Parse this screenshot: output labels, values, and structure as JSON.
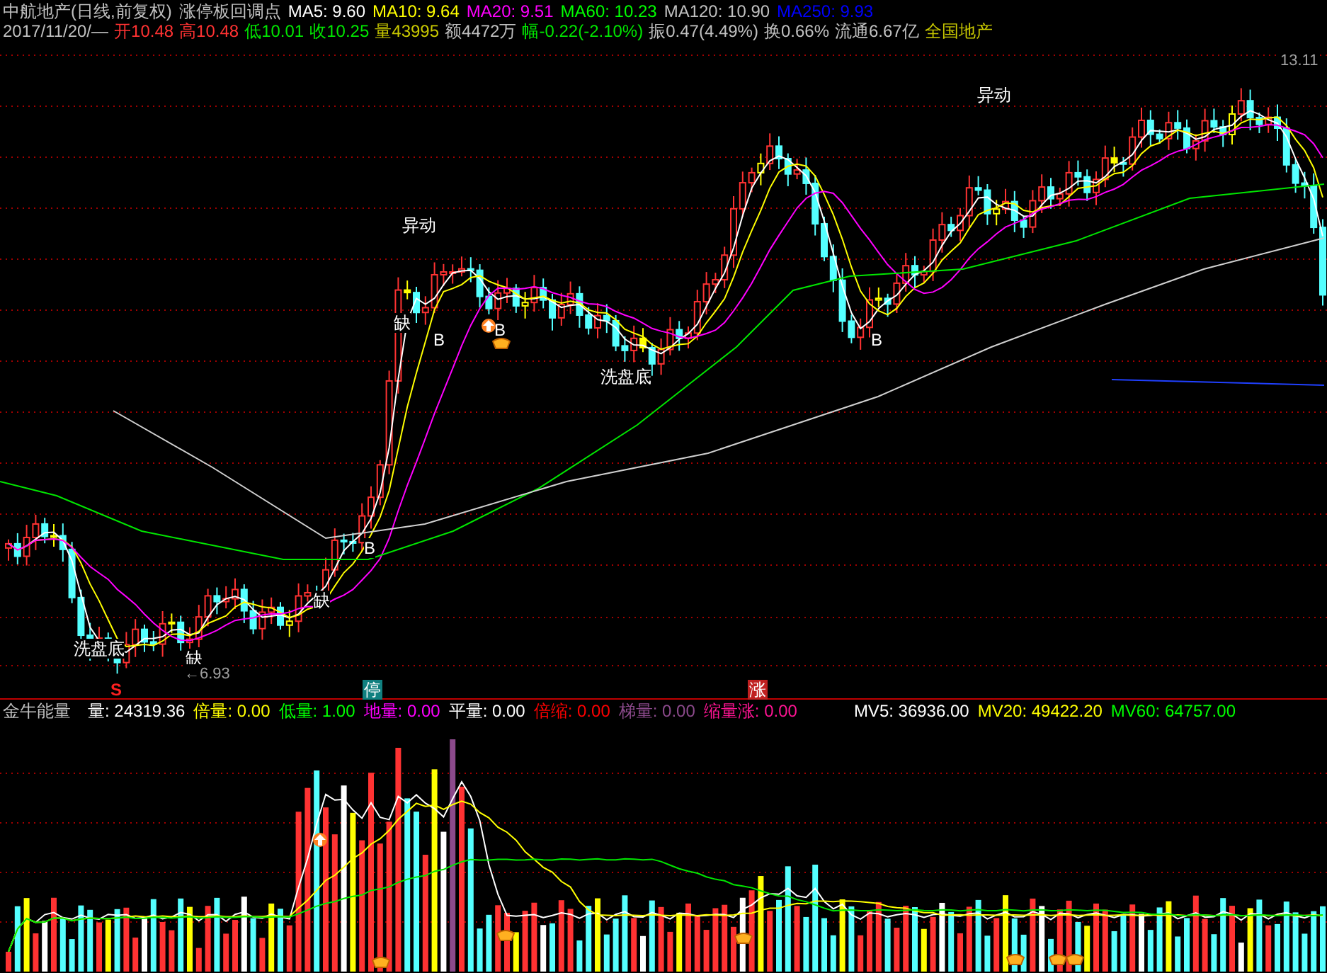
{
  "title_bar": {
    "stock": "中航地产(日线,前复权)",
    "indicator": "涨停板回调点",
    "ma_legend": [
      {
        "label": "MA5: 9.60",
        "color": "#ffffff"
      },
      {
        "label": "MA10: 9.64",
        "color": "#ffff00"
      },
      {
        "label": "MA20: 9.51",
        "color": "#ff00ff"
      },
      {
        "label": "MA60: 10.23",
        "color": "#00ff00"
      },
      {
        "label": "MA120: 10.90",
        "color": "#c0c0c0"
      },
      {
        "label": "MA250: 9.93",
        "color": "#0000ff"
      }
    ]
  },
  "quote": [
    {
      "text": "2017/11/20/—",
      "color": "#c0c0c0"
    },
    {
      "text": "开10.48",
      "color": "#ff3232"
    },
    {
      "text": "高10.48",
      "color": "#ff3232"
    },
    {
      "text": "低10.01",
      "color": "#00e600"
    },
    {
      "text": "收10.25",
      "color": "#00e600"
    },
    {
      "text": "量43995",
      "color": "#c8c800"
    },
    {
      "text": "额4472万",
      "color": "#c0c0c0"
    },
    {
      "text": "幅-0.22(-2.10%)",
      "color": "#00e600"
    },
    {
      "text": "振0.47(4.49%)",
      "color": "#c0c0c0"
    },
    {
      "text": "换0.66%",
      "color": "#c0c0c0"
    },
    {
      "text": "流通6.67亿",
      "color": "#c0c0c0"
    },
    {
      "text": "全国地产",
      "color": "#c8c800"
    }
  ],
  "chart_labels": [
    {
      "text": "异动",
      "kind": "signal"
    },
    {
      "text": "异动",
      "kind": "signal"
    },
    {
      "text": "缺",
      "kind": "signal"
    },
    {
      "text": "B",
      "kind": "signal"
    },
    {
      "text": "B",
      "kind": "signal"
    },
    {
      "text": "洗盘底",
      "kind": "signal"
    },
    {
      "text": "B",
      "kind": "signal"
    },
    {
      "text": "13.11",
      "kind": "price"
    },
    {
      "text": "B",
      "kind": "signal"
    },
    {
      "text": "缺",
      "kind": "signal"
    },
    {
      "text": "洗盘底",
      "kind": "signal"
    },
    {
      "text": "缺",
      "kind": "signal"
    },
    {
      "text": "←6.93",
      "kind": "price"
    }
  ],
  "markers": [
    {
      "text": "S",
      "kind": "sell"
    },
    {
      "text": "停",
      "kind": "limit"
    },
    {
      "text": "涨",
      "kind": "rise"
    }
  ],
  "indicator": {
    "name": "金牛能量",
    "readings": [
      {
        "text": "量: 24319.36",
        "color": "#ffffff"
      },
      {
        "text": "倍量: 0.00",
        "color": "#ffff00"
      },
      {
        "text": "低量: 1.00",
        "color": "#00ff00"
      },
      {
        "text": "地量: 0.00",
        "color": "#ff00ff"
      },
      {
        "text": "平量: 0.00",
        "color": "#ffffff"
      },
      {
        "text": "倍缩: 0.00",
        "color": "#ff0000"
      },
      {
        "text": "梯量: 0.00",
        "color": "#8c4a8c"
      },
      {
        "text": "缩量涨: 0.00",
        "color": "#ff1493"
      }
    ],
    "mv_legend": [
      {
        "label": "MV5: 36936.00",
        "color": "#ffffff"
      },
      {
        "label": "MV20: 49422.20",
        "color": "#ffff00"
      },
      {
        "label": "MV60: 64757.00",
        "color": "#00ff00"
      }
    ]
  }
}
